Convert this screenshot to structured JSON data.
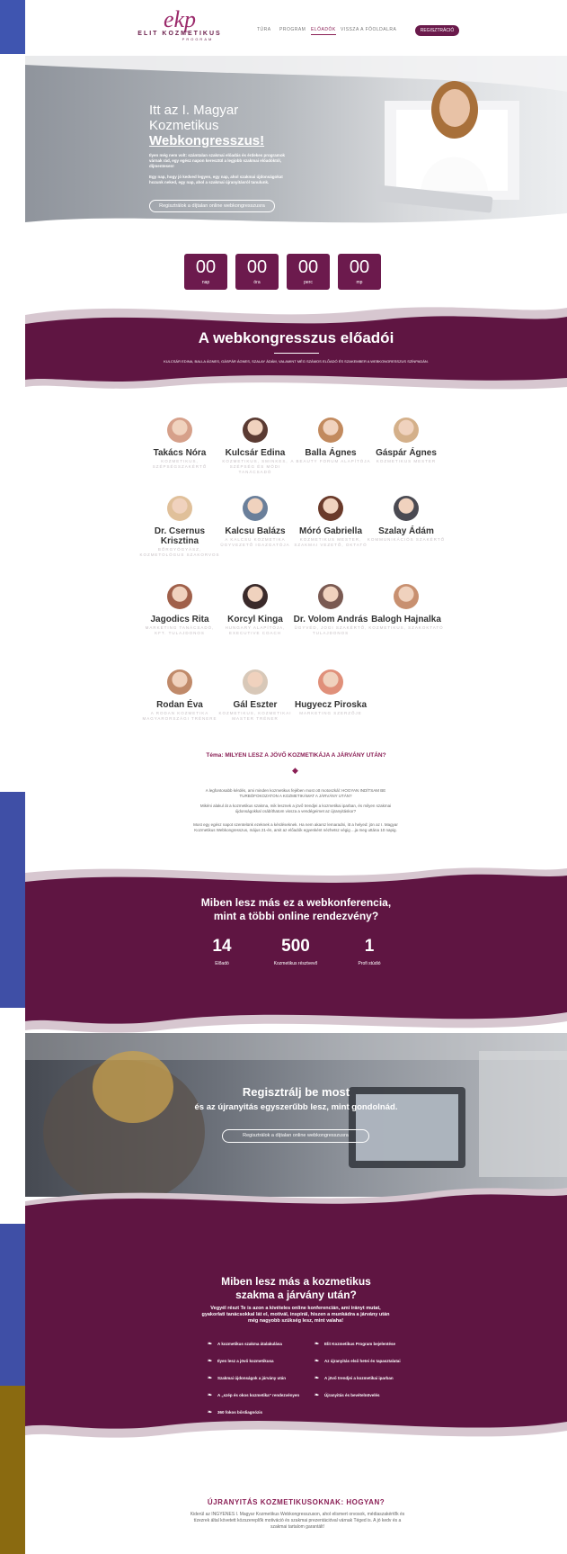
{
  "nav": {
    "logo_mark": "ekp",
    "logo_text": "ELIT KOZMETIKUS",
    "logo_sub": "PROGRAM",
    "items": [
      "TÚRA",
      "PROGRAM",
      "ELŐADÓK",
      "VISSZA A FŐOLDALRA"
    ],
    "register": "REGISZTRÁCIÓ"
  },
  "hero": {
    "title_line1": "Itt az I. Magyar",
    "title_line2": "Kozmetikus",
    "title_line3": "Webkongresszus!",
    "p1": "Ilyen még nem volt: számtalan szakmai előadás és érdekes programok várnak rád, egy egész napon keresztül a legjobb szakmai előadóktól, díjmentesen!",
    "p2": "Egy nap, hogy jó kedved legyen, egy nap, ahol szakmai újdonságokat hozunk neked, egy nap, ahol a szakmai újranyitásról tanulunk.",
    "cta": "Regisztrálok a díjtalan online webkongresszusra"
  },
  "countdown": [
    {
      "value": "00",
      "label": "nap"
    },
    {
      "value": "00",
      "label": "óra"
    },
    {
      "value": "00",
      "label": "perc"
    },
    {
      "value": "00",
      "label": "mp"
    }
  ],
  "speakers_band": {
    "title": "A webkongresszus előadói",
    "subtitle": "KULCSÁR EDINA, BALLA ÁGNES, GÁSPÁR ÁGNES, SZALAY ÁDÁM, VALAMINT MÉG SZÁMOS ELŐADÓ ÉS SZAKEMBER A WEBKONGRESSZUS SZÍNPADÁN."
  },
  "speakers": [
    {
      "name": "Takács Nóra",
      "desc": "KOZMETIKUS, SZÉPSÉGSZAKÉRTŐ",
      "color": "#d6a08a"
    },
    {
      "name": "Kulcsár Edina",
      "desc": "KOZMETIKUS, SMINKES, SZÉPSÉG ÉS MÓDI TANÁCSADÓ",
      "color": "#5a3a32"
    },
    {
      "name": "Balla Ágnes",
      "desc": "A BEAUTY FORUM ALAPÍTÓJA",
      "color": "#c28a5e"
    },
    {
      "name": "Gáspár Ágnes",
      "desc": "KOZMETIKUS MESTER",
      "color": "#d4b08a"
    },
    {
      "name": "Dr. Csernus Krisztina",
      "desc": "BŐRGYÓGYÁSZ, KOZMETOLÓGUS SZAKORVOS",
      "color": "#e0c09a"
    },
    {
      "name": "Kalcsu Balázs",
      "desc": "A KALCSU KOZMETIKA ÜGYVEZETŐ IGAZGATÓJA",
      "color": "#6a7f9a"
    },
    {
      "name": "Móró Gabriella",
      "desc": "KOZMETIKUS MESTER, SZAKMAI VEZETŐ, OKTATÓ",
      "color": "#6a3a2a"
    },
    {
      "name": "Szalay Ádám",
      "desc": "KOMMUNIKÁCIÓS SZAKÉRTŐ",
      "color": "#4a4a52"
    },
    {
      "name": "Jagodics Rita",
      "desc": "MARKETING TANÁCSADÓ, KFT. TULAJDONOS",
      "color": "#a0604a"
    },
    {
      "name": "Korcyl Kinga",
      "desc": "HUNGARY ALAPÍTÓJA, EXECUTIVE COACH",
      "color": "#3a2a2a"
    },
    {
      "name": "Dr. Volom András",
      "desc": "ÜGYVÉD, JOGI SZAKÉRTŐ, TULAJDONOS",
      "color": "#7a5a52"
    },
    {
      "name": "Balogh Hajnalka",
      "desc": "KOZMETIKUS, SZAKOKTATÓ",
      "color": "#c89070"
    },
    {
      "name": "Rodan Éva",
      "desc": "A RODAN KOZMETIKA MAGYARORSZÁGI TRÉNERE",
      "color": "#c08a6a"
    },
    {
      "name": "Gál Eszter",
      "desc": "KOZMETIKUS, KOZMETIKAI MASTER TRÉNER",
      "color": "#d8c8b8"
    },
    {
      "name": "Hugyecz Piroska",
      "desc": "MARKETING SZERZŐJE",
      "color": "#e0907a"
    }
  ],
  "theme": {
    "title": "Téma: MILYEN LESZ A JÖVŐ KOZMETIKÁJA A JÁRVÁNY UTÁN?",
    "p1": "A legfontosabb kérdés, ami minden kozmetikus fejében most ott motoszkál: HOGYAN INDÍTSAM BE TURBÓFOKOZATON A KOZMETIKÁMAT A JÁRVÁNY UTÁN?",
    "p2": "Mikéni alakul át a kozmetikus szakma, mik lesznek a jövő trendjei a kozmetikai iparban, és milyen szakmai újdonságokkal csábíthatom vissza a vendégeimet az újranyitáskor?",
    "p3": "Most egy egész napot szentelünk ezeknek a kérdéseknek. Ha nem akarsz lemaradni, itt a helyed: jön az I. Magyar Kozmetikus Webkongresszus, május 21-én, amit az előadók egyenként nézhetsz végig ...ja meg uttána 10 napig."
  },
  "diff": {
    "title_line1": "Miben lesz más ez a webkonferencia,",
    "title_line2": "mint a többi online rendezvény?",
    "stats": [
      {
        "n": "14",
        "l": "Előadó"
      },
      {
        "n": "500",
        "l": "Kozmetikus résztvevő"
      },
      {
        "n": "1",
        "l": "Profi stúdió"
      }
    ]
  },
  "register_band": {
    "title": "Regisztrálj be most",
    "subtitle": "és az újranyitás egyszerűbb lesz, mint gondolnád.",
    "cta": "Regisztrálok a díjtalan online webkongresszusra"
  },
  "after": {
    "title_line1": "Miben lesz más a kozmetikus",
    "title_line2": "szakma a járvány után?",
    "intro": "Vegyél részt Te is azon a kivételes online konferencián, ami irányt mutat, gyakorlati tanácsokkal lát el, motivál, inspirál, hiszen a munkádra a járvány után még nagyobb szükség lesz, mint valaha!",
    "left": [
      "A kozmetikus szakma átalakulása",
      "Ilyen lesz a jövő kozmetikusa",
      "Szakmai újdonságok a járvány után",
      "A „szép és okos kozmetika” rendezvényen",
      "360 fokos bőrdiagnózis"
    ],
    "right": [
      "Elit Kozmetikus Program bejelentése",
      "Az újranyitás első hetei és tapasztalatai",
      "A jövő trendjei a kozmetikai iparban",
      "Újranyitás és bevételnövelés"
    ]
  },
  "bottom": {
    "title": "ÚJRANYITÁS KOZMETIKUSOKNAK: HOGYAN?",
    "text": "Kiderül az INGYENES I. Magyar Kozmetikus Webkongresszuson, ahol elismert orvosok, médiaszakértők és tízezrek által követett közszereplők motiváció és szakmai prezentációval várnak Téged is. A jó kedv és a szakmai tartalom garantált!"
  },
  "colors": {
    "brand": "#6a1a4b",
    "band": "#5f1542",
    "accent": "#8a1f55",
    "outer": "#3f4fa6"
  }
}
